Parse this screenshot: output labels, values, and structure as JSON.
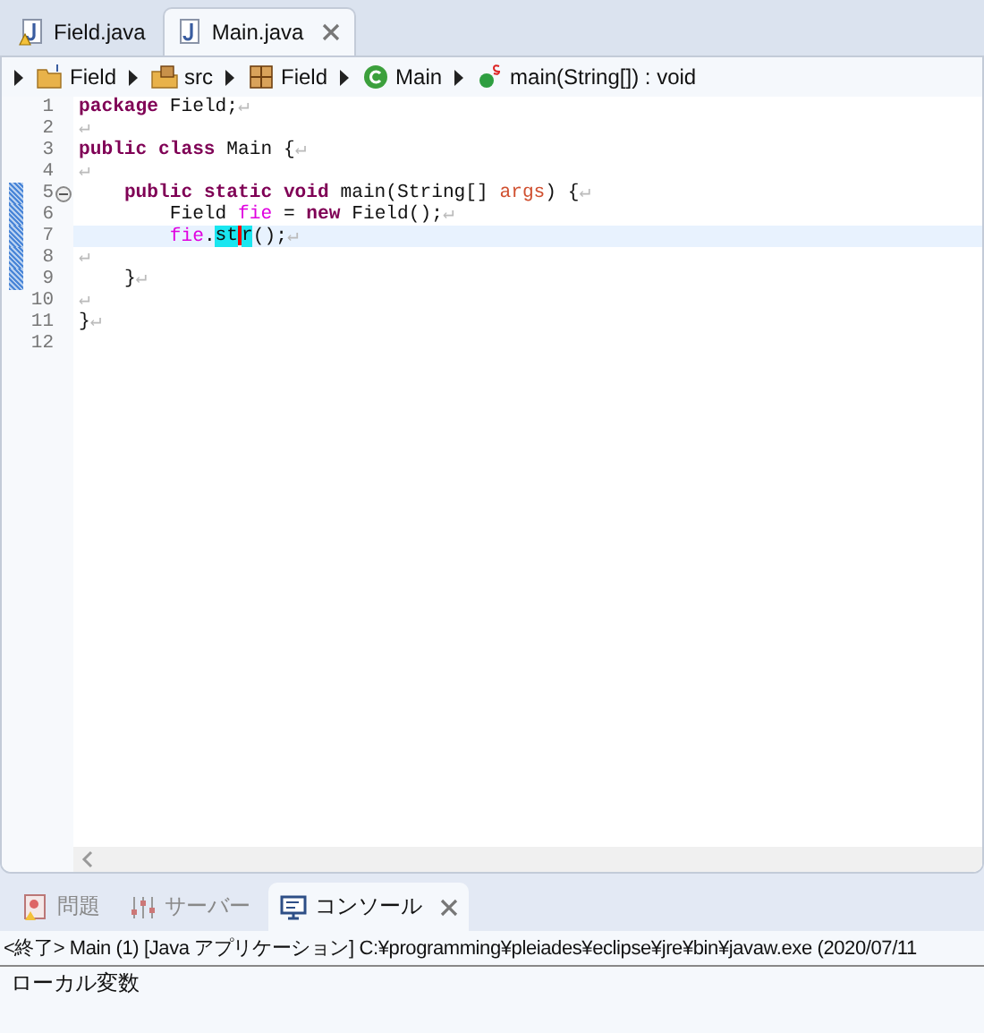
{
  "editor_tabs": [
    {
      "label": "Field.java",
      "selected": false,
      "warning": true
    },
    {
      "label": "Main.java",
      "selected": true,
      "warning": false
    }
  ],
  "breadcrumb": [
    {
      "kind": "project",
      "label": "Field"
    },
    {
      "kind": "source",
      "label": "src"
    },
    {
      "kind": "package",
      "label": "Field"
    },
    {
      "kind": "class",
      "label": "Main"
    },
    {
      "kind": "method",
      "label": "main(String[]) : void"
    }
  ],
  "code_lines": [
    {
      "number": "1",
      "current": false,
      "in_range": false,
      "tokens": [
        {
          "kind": "keyword",
          "text": "package"
        },
        {
          "kind": "plain",
          "text": " Field;"
        },
        {
          "kind": "eol",
          "text": "↵"
        }
      ]
    },
    {
      "number": "2",
      "current": false,
      "in_range": false,
      "tokens": [
        {
          "kind": "eol",
          "text": "↵"
        }
      ]
    },
    {
      "number": "3",
      "current": false,
      "in_range": false,
      "tokens": [
        {
          "kind": "keyword",
          "text": "public class"
        },
        {
          "kind": "plain",
          "text": " Main {"
        },
        {
          "kind": "eol",
          "text": "↵"
        }
      ]
    },
    {
      "number": "4",
      "current": false,
      "in_range": false,
      "tokens": [
        {
          "kind": "eol",
          "text": "↵"
        }
      ]
    },
    {
      "number": "5",
      "current": false,
      "in_range": true,
      "fold": true,
      "tokens": [
        {
          "kind": "keyword",
          "text": "\tpublic static void"
        },
        {
          "kind": "plain",
          "text": " main(String[] "
        },
        {
          "kind": "param",
          "text": "args"
        },
        {
          "kind": "plain",
          "text": ") {"
        },
        {
          "kind": "eol",
          "text": "↵"
        }
      ]
    },
    {
      "number": "6",
      "current": false,
      "in_range": true,
      "tokens": [
        {
          "kind": "plain",
          "text": "\t\tField "
        },
        {
          "kind": "local",
          "text": "fie"
        },
        {
          "kind": "plain",
          "text": " = "
        },
        {
          "kind": "keyword",
          "text": "new"
        },
        {
          "kind": "plain",
          "text": " Field();"
        },
        {
          "kind": "eol",
          "text": "↵"
        }
      ]
    },
    {
      "number": "7",
      "current": true,
      "in_range": true,
      "tokens": [
        {
          "kind": "local",
          "text": "\t\tfie"
        },
        {
          "kind": "plain",
          "text": "."
        },
        {
          "kind": "match",
          "text": "st",
          "caret_after": true
        },
        {
          "kind": "match",
          "text": "r",
          "caret_after": false
        },
        {
          "kind": "plain",
          "text": "();"
        },
        {
          "kind": "eol",
          "text": "↵"
        }
      ]
    },
    {
      "number": "8",
      "current": false,
      "in_range": true,
      "tokens": [
        {
          "kind": "eol",
          "text": "↵"
        }
      ]
    },
    {
      "number": "9",
      "current": false,
      "in_range": true,
      "tokens": [
        {
          "kind": "plain",
          "text": "\t}"
        },
        {
          "kind": "eol",
          "text": "↵"
        }
      ]
    },
    {
      "number": "10",
      "current": false,
      "in_range": false,
      "tokens": [
        {
          "kind": "eol",
          "text": "↵"
        }
      ]
    },
    {
      "number": "11",
      "current": false,
      "in_range": false,
      "tokens": [
        {
          "kind": "plain",
          "text": "}"
        },
        {
          "kind": "eol",
          "text": "↵"
        }
      ]
    },
    {
      "number": "12",
      "current": false,
      "in_range": false
    }
  ],
  "bottom_tabs": [
    {
      "kind": "problems",
      "label": "問題",
      "selected": false
    },
    {
      "kind": "servers",
      "label": "サーバー",
      "selected": false
    },
    {
      "kind": "console",
      "label": "コンソール",
      "selected": true
    }
  ],
  "console": {
    "header": "<終了> Main (1) [Java アプリケーション] C:¥programming¥pleiades¥eclipse¥jre¥bin¥javaw.exe  (2020/07/11",
    "output": "ローカル変数"
  }
}
